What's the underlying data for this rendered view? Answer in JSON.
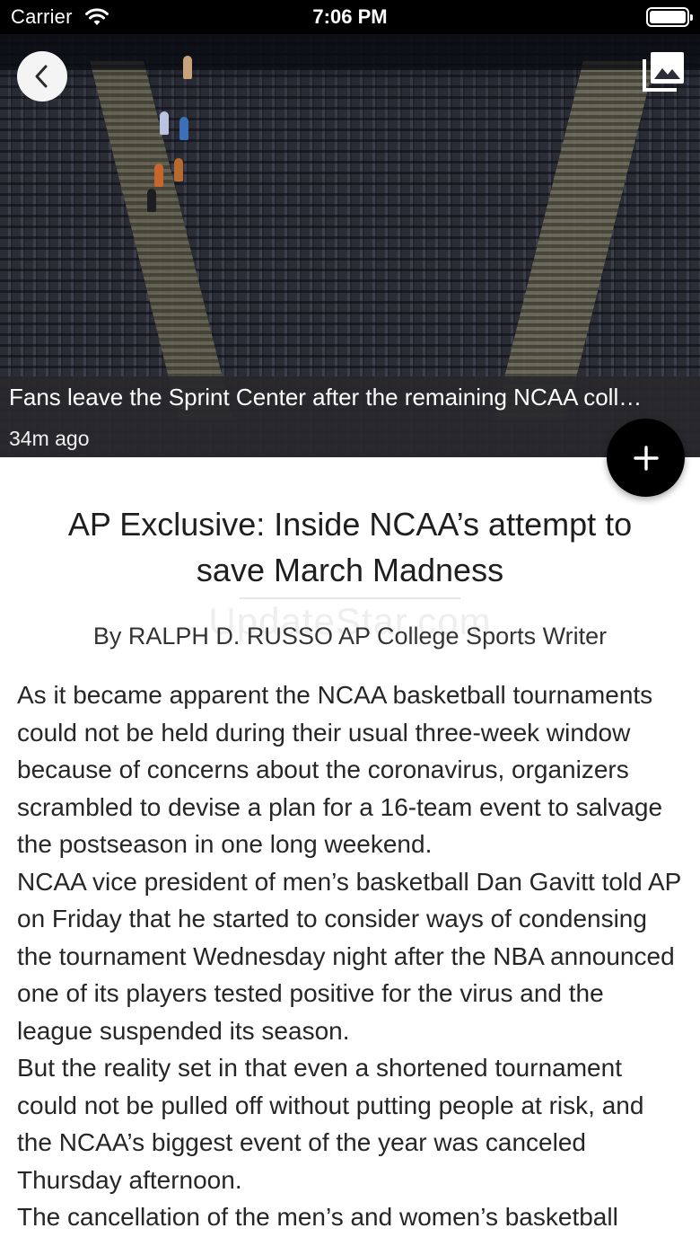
{
  "status_bar": {
    "carrier": "Carrier",
    "time": "7:06 PM"
  },
  "hero": {
    "caption": "Fans leave the Sprint Center after the remaining NCAA coll…",
    "timestamp": "34m ago"
  },
  "article": {
    "headline": "AP Exclusive: Inside NCAA’s attempt to save March Madness",
    "watermark": "UpdateStar.com",
    "byline": "By RALPH D. RUSSO AP College Sports Writer",
    "paragraphs": [
      "As it became apparent the NCAA basketball tournaments could not be held during their usual three-week window because of concerns about the coronavirus, organizers scrambled to devise a plan for a 16-team event to salvage the postseason in one long weekend.",
      "NCAA vice president of men’s basketball Dan Gavitt told AP on Friday that he started to consider ways of condensing the tournament Wednesday night after the NBA announced one of its players tested positive for the virus and the league suspended its season.",
      "But the reality set in that even a shortened tournament could not be pulled off without putting people at risk, and the NCAA’s biggest event of the year was canceled Thursday afternoon.",
      "The cancellation of the men’s and women’s basketball"
    ]
  },
  "icons": {
    "back": "chevron-left-icon",
    "gallery": "photo-gallery-icon",
    "add": "plus-icon",
    "wifi": "wifi-icon",
    "battery": "battery-icon"
  },
  "colors": {
    "status_bar_bg": "#000000",
    "caption_bg": "#28282C",
    "fab_bg": "#000000",
    "text": "#262626"
  }
}
